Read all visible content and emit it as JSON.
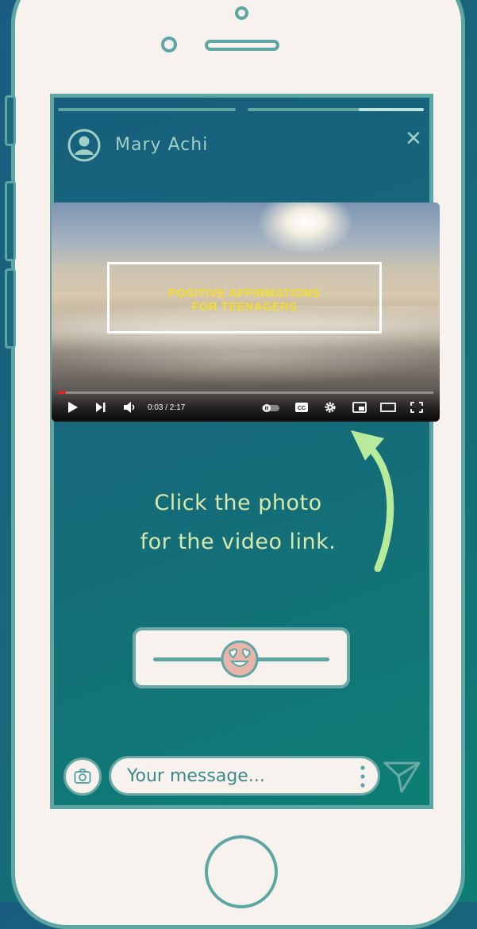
{
  "profile": {
    "name": "Mary Achi"
  },
  "story": {
    "segments": 2,
    "active_segment": 2,
    "progress": 0.6
  },
  "video": {
    "title_line1": "POSITIVE AFFIRMATIONS",
    "title_line2": "FOR TEENAGERS",
    "time": "0:03 / 2:17",
    "played_fraction": 0.022
  },
  "caption": {
    "line1": "Click the photo",
    "line2": "for the video link."
  },
  "reaction_slider": {
    "icon": "heart-eyes-emoji-icon",
    "level": 0.4
  },
  "message": {
    "placeholder": "Your message..."
  },
  "colors": {
    "accent": "#5ea6a3",
    "caption": "#d9e9ad",
    "arrow": "#b8ea9c",
    "video_title": "#f2de2d"
  }
}
